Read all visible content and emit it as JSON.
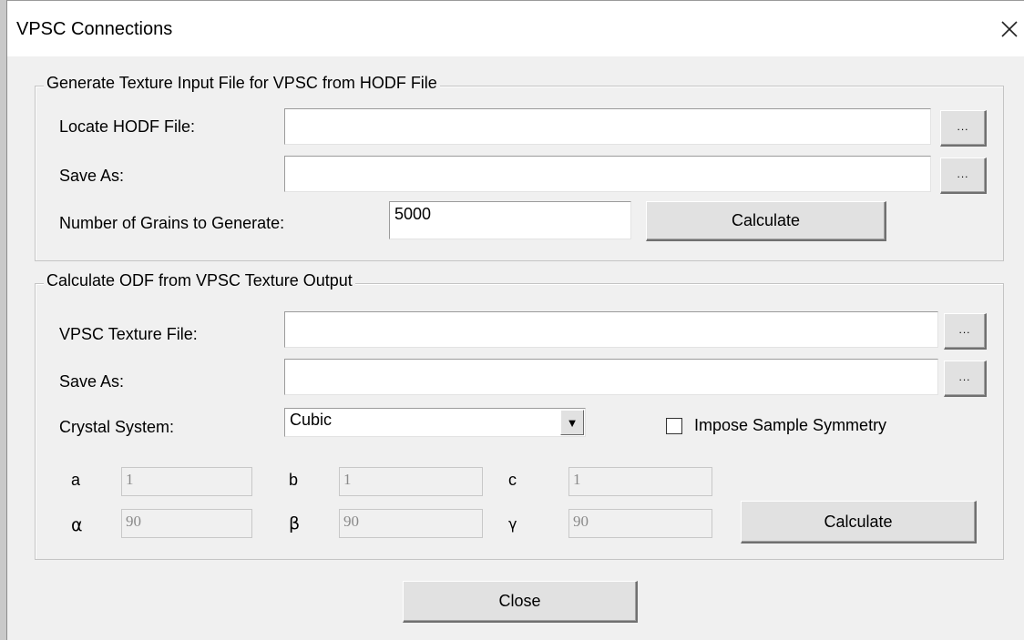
{
  "window": {
    "title": "VPSC Connections",
    "close_glyph": "✕",
    "close_icon": "close-icon"
  },
  "generate": {
    "legend": "Generate Texture Input File for VPSC from HODF File",
    "hodf_label": "Locate HODF File:",
    "hodf_value": "",
    "hodf_browse": "...",
    "save_as_label": "Save As:",
    "save_as_value": "",
    "save_as_browse": "...",
    "grains_label": "Number of Grains to Generate:",
    "grains_value": "5000",
    "calculate_label": "Calculate"
  },
  "odf": {
    "legend": "Calculate ODF from VPSC Texture Output",
    "texture_label": "VPSC Texture File:",
    "texture_value": "",
    "texture_browse": "...",
    "save_as_label": "Save As:",
    "save_as_value": "",
    "save_as_browse": "...",
    "crystal_label": "Crystal System:",
    "crystal_value": "Cubic",
    "crystal_arrow": "▼",
    "symmetry_label": "Impose Sample Symmetry",
    "symmetry_checked": false,
    "lattice": {
      "a_label": "a",
      "a_value": "1",
      "b_label": "b",
      "b_value": "1",
      "c_label": "c",
      "c_value": "1",
      "alpha_label": "α",
      "alpha_value": "90",
      "beta_label": "β",
      "beta_value": "90",
      "gamma_label": "γ",
      "gamma_value": "90"
    },
    "calculate_label": "Calculate"
  },
  "footer": {
    "close_label": "Close"
  }
}
